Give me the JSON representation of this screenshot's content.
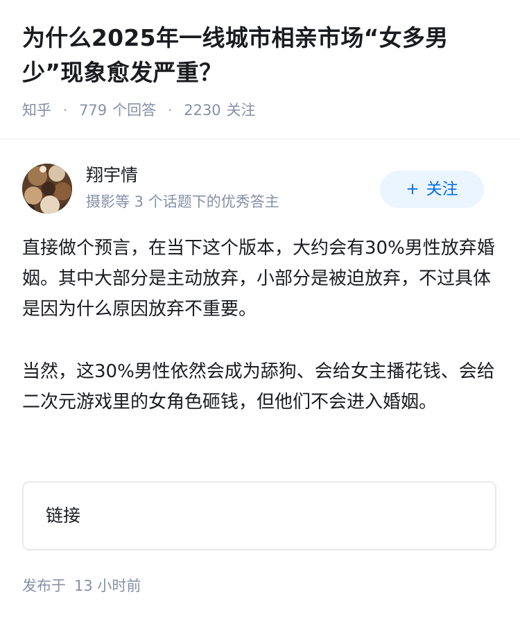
{
  "question": {
    "title": "为什么2025年一线城市相亲市场“女多男少”现象愈发严重？",
    "source": "知乎",
    "answers_count": "779",
    "answers_label": "个回答",
    "followers_count": "2230",
    "followers_label": "关注"
  },
  "author": {
    "name": "翔宇情",
    "description": "摄影等 3 个话题下的优秀答主",
    "follow_label": "关注",
    "follow_icon": "plus-icon"
  },
  "answer": {
    "paragraphs": [
      "直接做个预言，在当下这个版本，大约会有30%男性放弃婚姻。其中大部分是主动放弃，小部分是被迫放弃，不过具体是因为什么原因放弃不重要。",
      "当然，这30%男性依然会成为舔狗、会给女主播花钱、会给二次元游戏里的女角色砸钱，但他们不会进入婚姻。"
    ],
    "link_label": "链接"
  },
  "footer": {
    "posted_prefix": "发布于",
    "posted_time": "13 小时前"
  },
  "colors": {
    "accent": "#056de8",
    "accent_bg": "#ebf5ff",
    "meta": "#8590a6",
    "text": "#191b1f"
  }
}
